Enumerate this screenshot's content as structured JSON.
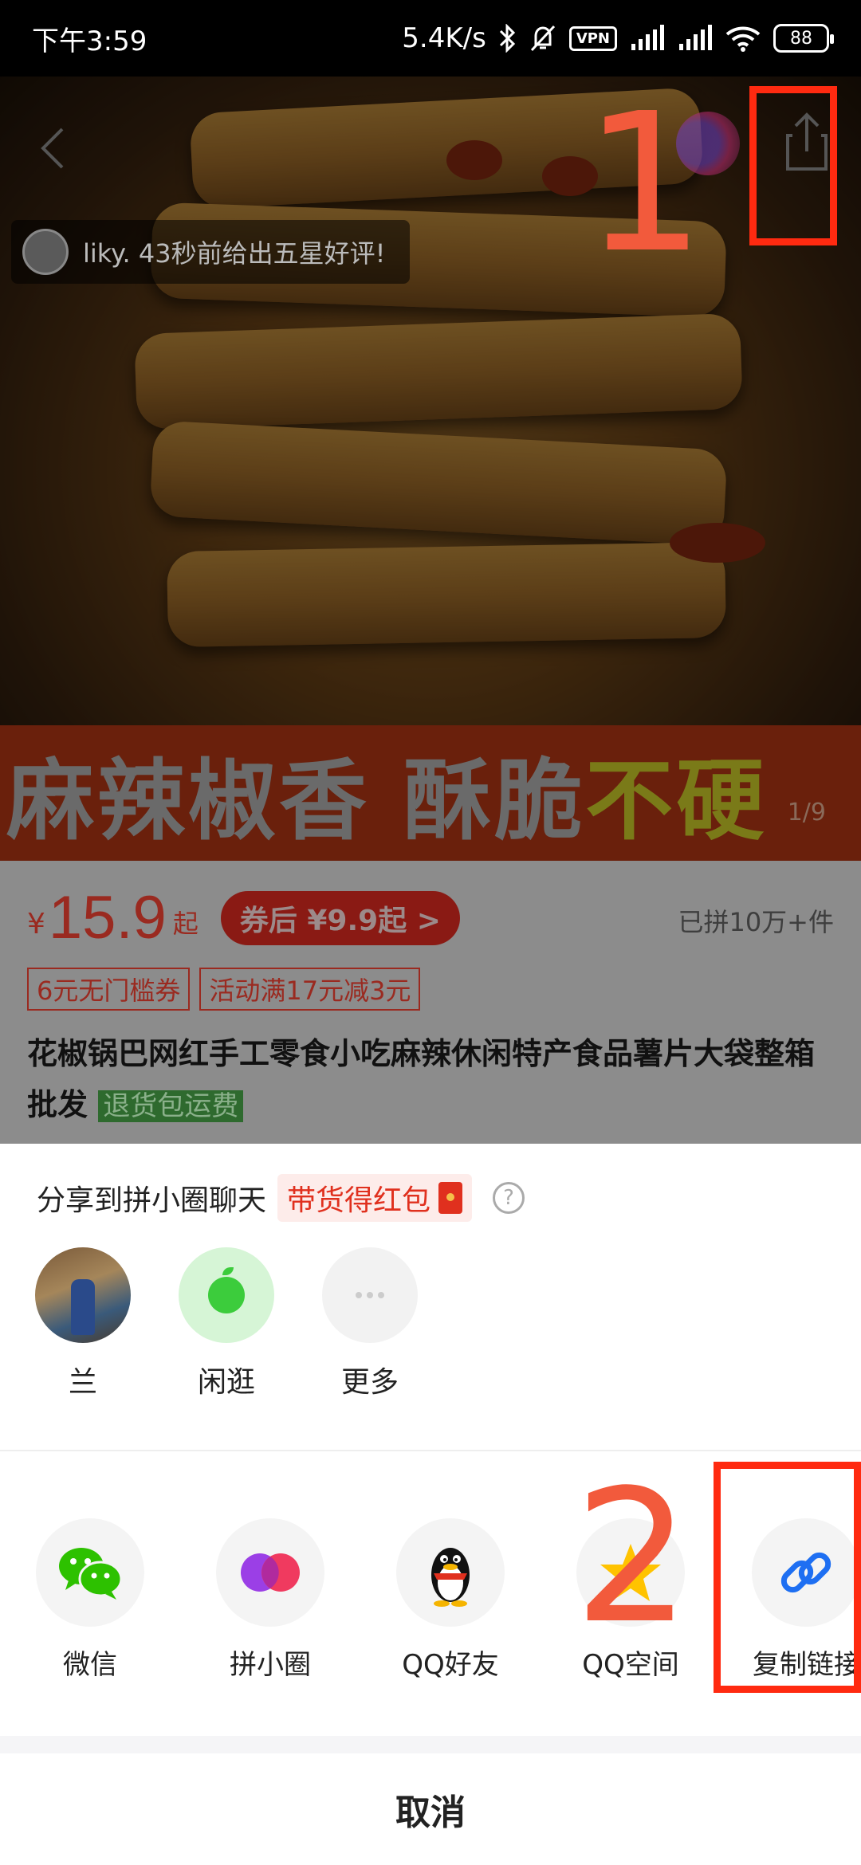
{
  "status_bar": {
    "time": "下午3:59",
    "net_speed": "5.4K/s",
    "vpn": "VPN",
    "battery": "88"
  },
  "product": {
    "review_toast": "liky. 43秒前给出五星好评!",
    "banner_text_main": "麻辣椒香 酥脆",
    "banner_text_highlight": "不硬",
    "page_indicator": "1/9",
    "price_symbol": "¥",
    "price": "15.9",
    "price_suffix": "起",
    "coupon_price": "券后 ¥9.9起 >",
    "group_count": "已拼10万+件",
    "tags": [
      "6元无门槛券",
      "活动满17元减3元"
    ],
    "title": "花椒锅巴网红手工零食小吃麻辣休闲特产食品薯片大袋整箱批发",
    "return_tag": "退货包运费"
  },
  "annotations": {
    "step1": "1",
    "step2": "2"
  },
  "share_sheet": {
    "header": "分享到拼小圈聊天",
    "reward_badge": "带货得红包",
    "help": "?",
    "contacts": [
      {
        "label": "兰",
        "icon": "avatar-photo"
      },
      {
        "label": "闲逛",
        "icon": "green-apple-icon"
      },
      {
        "label": "更多",
        "icon": "more-dots-icon"
      }
    ],
    "channels": [
      {
        "label": "微信",
        "icon": "wechat-icon",
        "color": "#2DC100"
      },
      {
        "label": "拼小圈",
        "icon": "pinxiaoquan-icon",
        "color": "#B33FE0"
      },
      {
        "label": "QQ好友",
        "icon": "qq-penguin-icon",
        "color": "#000000"
      },
      {
        "label": "QQ空间",
        "icon": "qzone-star-icon",
        "color": "#FFC300"
      },
      {
        "label": "复制链接",
        "icon": "link-icon",
        "color": "#1E6FF2"
      }
    ],
    "cancel": "取消"
  },
  "colors": {
    "accent_red": "#E0301E",
    "annotation": "#FF2A10",
    "link_blue": "#1E6FF2"
  }
}
